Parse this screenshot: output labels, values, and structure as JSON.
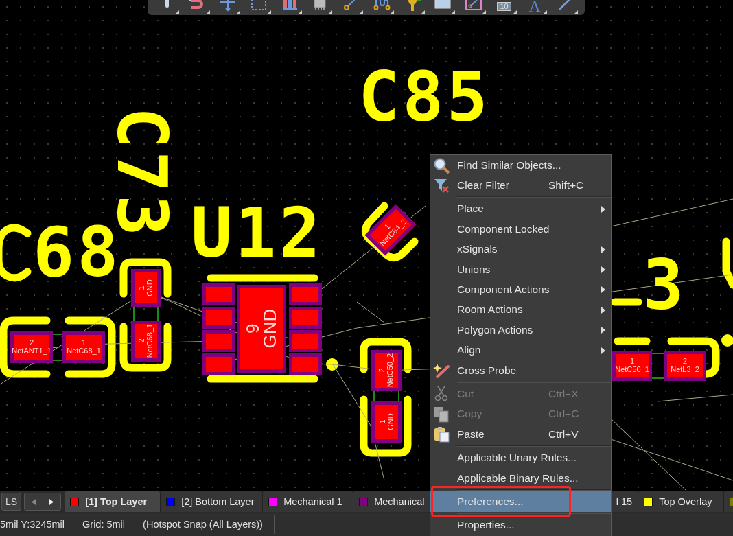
{
  "toolbar": {
    "items": [
      {
        "kind": "pin"
      },
      {
        "kind": "magnet"
      },
      {
        "kind": "cross"
      },
      {
        "kind": "select"
      },
      {
        "kind": "bars"
      },
      {
        "kind": "chip"
      },
      {
        "kind": "route"
      },
      {
        "kind": "diff"
      },
      {
        "kind": "via"
      },
      {
        "kind": "fill"
      },
      {
        "kind": "board"
      },
      {
        "kind": "text",
        "label": "10"
      },
      {
        "kind": "text",
        "label": "A"
      },
      {
        "kind": "line"
      }
    ]
  },
  "canvas": {
    "designators": [
      "C85",
      "C73",
      "68",
      "U12",
      "3"
    ],
    "pads": [
      {
        "pin": "2",
        "net": "NetANT1_1"
      },
      {
        "pin": "1",
        "net": "NetC68_1"
      },
      {
        "pin": "1",
        "net": "GND"
      },
      {
        "pin": "2",
        "net": "NetC68_1"
      },
      {
        "pin": "9",
        "net": "GND"
      },
      {
        "pin": "1",
        "net": "NetC84_2"
      },
      {
        "pin": "2",
        "net": "NetC50_2"
      },
      {
        "pin": "1",
        "net": "GND"
      },
      {
        "pin": "1",
        "net": "NetC50_1"
      },
      {
        "pin": "2",
        "net": "NetL3_2"
      }
    ]
  },
  "context_menu": {
    "items": [
      {
        "kind": "item",
        "label": "Find Similar Objects...",
        "submenu": false,
        "disabled": false,
        "selected": false
      },
      {
        "kind": "item",
        "label": "Clear Filter",
        "shortcut": "Shift+C",
        "submenu": false,
        "disabled": false,
        "selected": false
      },
      {
        "kind": "separator"
      },
      {
        "kind": "item",
        "label": "Place",
        "submenu": true,
        "disabled": false,
        "selected": false
      },
      {
        "kind": "item",
        "label": "Component Locked",
        "submenu": false,
        "disabled": false,
        "selected": false
      },
      {
        "kind": "item",
        "label": "xSignals",
        "submenu": true,
        "disabled": false,
        "selected": false
      },
      {
        "kind": "item",
        "label": "Unions",
        "submenu": true,
        "disabled": false,
        "selected": false
      },
      {
        "kind": "item",
        "label": "Component Actions",
        "submenu": true,
        "disabled": false,
        "selected": false
      },
      {
        "kind": "item",
        "label": "Room Actions",
        "submenu": true,
        "disabled": false,
        "selected": false
      },
      {
        "kind": "item",
        "label": "Polygon Actions",
        "submenu": true,
        "disabled": false,
        "selected": false
      },
      {
        "kind": "item",
        "label": "Align",
        "submenu": true,
        "disabled": false,
        "selected": false
      },
      {
        "kind": "item",
        "label": "Cross Probe",
        "submenu": false,
        "disabled": false,
        "selected": false
      },
      {
        "kind": "separator"
      },
      {
        "kind": "item",
        "label": "Cut",
        "shortcut": "Ctrl+X",
        "submenu": false,
        "disabled": true,
        "selected": false
      },
      {
        "kind": "item",
        "label": "Copy",
        "shortcut": "Ctrl+C",
        "submenu": false,
        "disabled": true,
        "selected": false
      },
      {
        "kind": "item",
        "label": "Paste",
        "shortcut": "Ctrl+V",
        "submenu": false,
        "disabled": false,
        "selected": false
      },
      {
        "kind": "separator"
      },
      {
        "kind": "item",
        "label": "Applicable Unary Rules...",
        "submenu": false,
        "disabled": false,
        "selected": false
      },
      {
        "kind": "item",
        "label": "Applicable Binary Rules...",
        "submenu": false,
        "disabled": false,
        "selected": false
      },
      {
        "kind": "separator"
      },
      {
        "kind": "item",
        "label": "Preferences...",
        "submenu": false,
        "disabled": false,
        "selected": true
      },
      {
        "kind": "separator"
      },
      {
        "kind": "item",
        "label": "Properties...",
        "submenu": false,
        "disabled": false,
        "selected": false
      }
    ]
  },
  "layer_bar": {
    "set_button": "LS",
    "tabs": [
      {
        "label": "[1] Top Layer",
        "color": "#ff0000",
        "selected": true
      },
      {
        "label": "[2] Bottom Layer",
        "color": "#0000ff",
        "selected": false
      },
      {
        "label": "Mechanical 1",
        "color": "#ff00ff",
        "selected": false
      },
      {
        "label": "Mechanical",
        "color": "#800080",
        "selected": false
      },
      {
        "label": "l 15",
        "selected": false
      },
      {
        "label": "Top Overlay",
        "color": "#ffff00",
        "selected": false
      },
      {
        "color": "#808000",
        "selected": false
      }
    ]
  },
  "status_bar": {
    "coordinates": "5mil Y:3245mil",
    "grid": "Grid: 5mil",
    "snap": "(Hotspot Snap (All Layers))"
  }
}
